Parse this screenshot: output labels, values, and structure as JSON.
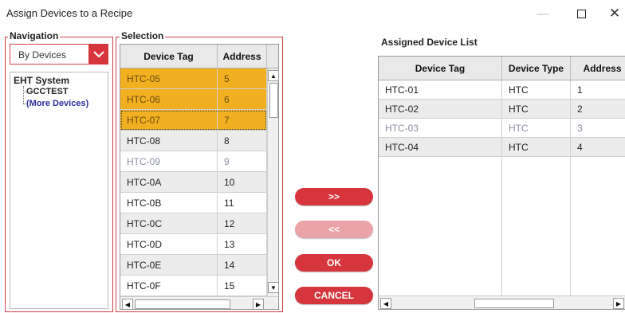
{
  "window": {
    "title": "Assign Devices to a Recipe",
    "minimize": "—",
    "close": "✕"
  },
  "navigation": {
    "label": "Navigation",
    "select_value": "By Devices",
    "tree": {
      "root": "EHT System",
      "children": [
        "GCCTEST",
        "(More Devices)"
      ]
    }
  },
  "selection": {
    "label": "Selection",
    "columns": [
      "Device Tag",
      "Address"
    ],
    "rows": [
      {
        "tag": "HTC-05",
        "address": "5",
        "state": "selected"
      },
      {
        "tag": "HTC-06",
        "address": "6",
        "state": "selected"
      },
      {
        "tag": "HTC-07",
        "address": "7",
        "state": "selected-focus"
      },
      {
        "tag": "HTC-08",
        "address": "8",
        "state": "alt"
      },
      {
        "tag": "HTC-09",
        "address": "9",
        "state": "dim"
      },
      {
        "tag": "HTC-0A",
        "address": "10",
        "state": "alt"
      },
      {
        "tag": "HTC-0B",
        "address": "11",
        "state": "normal"
      },
      {
        "tag": "HTC-0C",
        "address": "12",
        "state": "alt"
      },
      {
        "tag": "HTC-0D",
        "address": "13",
        "state": "normal"
      },
      {
        "tag": "HTC-0E",
        "address": "14",
        "state": "alt"
      },
      {
        "tag": "HTC-0F",
        "address": "15",
        "state": "normal"
      }
    ]
  },
  "buttons": {
    "add": ">>",
    "remove": "<<",
    "ok": "OK",
    "cancel": "CANCEL"
  },
  "assigned": {
    "title": "Assigned Device List",
    "columns": [
      "Device Tag",
      "Device Type",
      "Address"
    ],
    "rows": [
      {
        "tag": "HTC-01",
        "type": "HTC",
        "address": "1",
        "state": "normal"
      },
      {
        "tag": "HTC-02",
        "type": "HTC",
        "address": "2",
        "state": "alt"
      },
      {
        "tag": "HTC-03",
        "type": "HTC",
        "address": "3",
        "state": "dim"
      },
      {
        "tag": "HTC-04",
        "type": "HTC",
        "address": "4",
        "state": "alt"
      }
    ]
  },
  "colors": {
    "accent": "#d6353d",
    "selected_row": "#f0b020",
    "disabled_button": "#eaa3a7"
  }
}
